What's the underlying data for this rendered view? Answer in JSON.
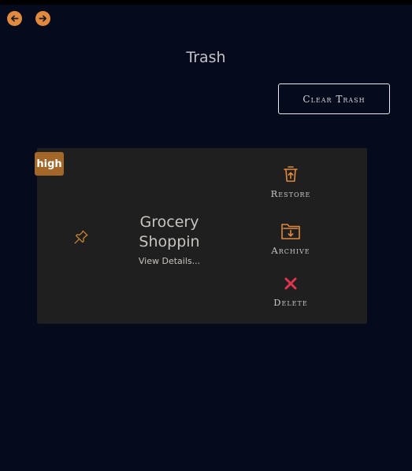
{
  "page": {
    "title": "Trash"
  },
  "toolbar": {
    "clear_label": "Clear Trash"
  },
  "note": {
    "priority": "high",
    "title_line1": "Grocery",
    "title_line2": "Shoppin",
    "view_details": "View Details..."
  },
  "actions": {
    "restore": "Restore",
    "archive": "Archive",
    "delete": "Delete"
  },
  "colors": {
    "background": "#060a1d",
    "accent": "#e0893f",
    "badge": "#a3672a",
    "card": "#1f1f1f",
    "delete": "#e0354f"
  },
  "icons": {
    "back": "arrow-left-icon",
    "forward": "arrow-right-icon",
    "pin": "pin-icon",
    "restore": "trash-restore-icon",
    "archive": "folder-archive-icon",
    "delete": "close-x-icon"
  }
}
